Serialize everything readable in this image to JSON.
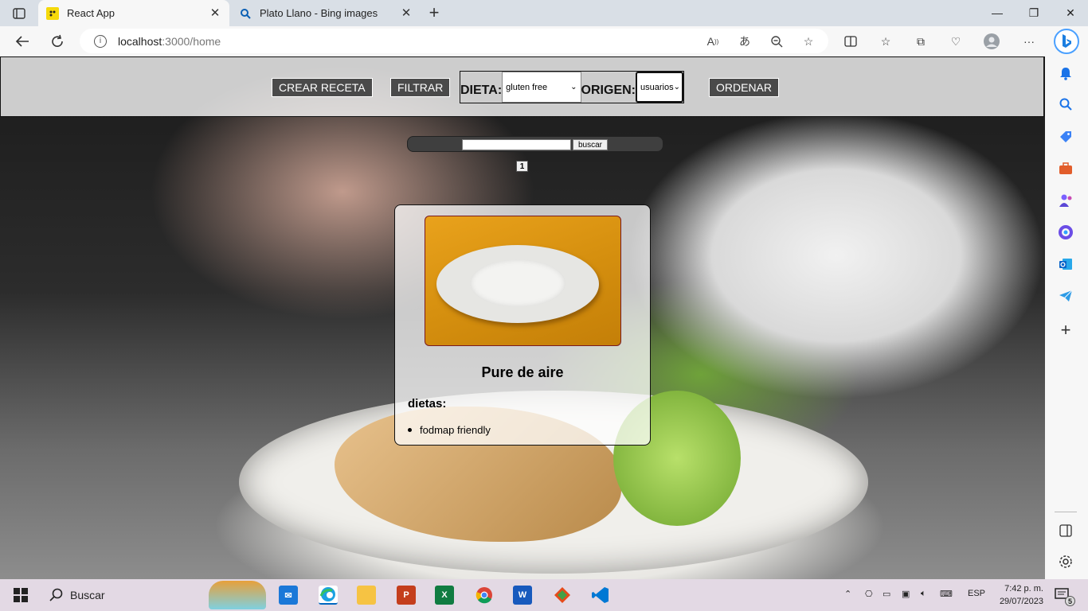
{
  "browser": {
    "tabs": [
      {
        "title": "React App",
        "active": true
      },
      {
        "title": "Plato Llano - Bing images",
        "active": false
      }
    ],
    "url_host": "localhost",
    "url_rest": ":3000/home"
  },
  "nav": {
    "create_label": "CREAR RECETA",
    "filter_label": "FILTRAR",
    "diet_label": "DIETA:",
    "diet_value": "gluten free",
    "origin_label": "ORIGEN:",
    "origin_value": "usuarios",
    "sort_label": "ORDENAR"
  },
  "search": {
    "button_label": "buscar"
  },
  "pagination": {
    "pages": [
      "1"
    ]
  },
  "card": {
    "title": "Pure de aire",
    "diets_label": "dietas:",
    "diets": [
      "fodmap friendly"
    ]
  },
  "taskbar": {
    "search_label": "Buscar",
    "language": "ESP",
    "time": "7:42 p. m.",
    "date": "29/07/2023",
    "notifications": "5"
  },
  "colors": {
    "accent": "#0067c0",
    "nav_button_bg": "#4a4a4a",
    "card_image_bg": "#e9a21c"
  }
}
